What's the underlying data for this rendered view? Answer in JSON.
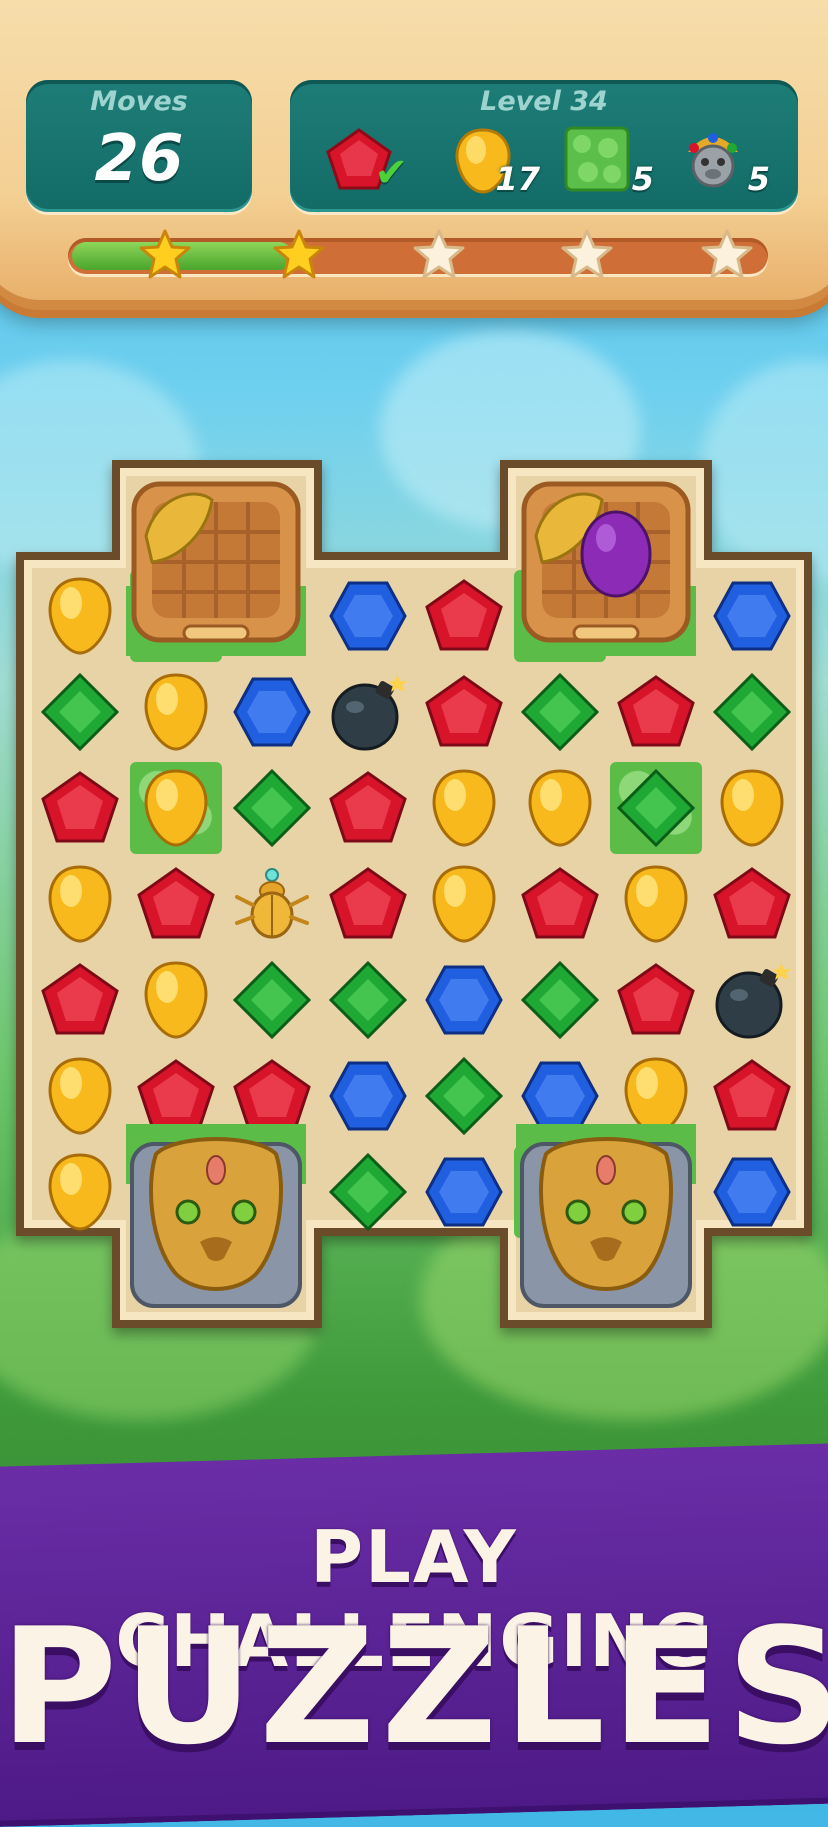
{
  "hud": {
    "moves_label": "Moves",
    "moves_value": "26",
    "level_label": "Level 34",
    "goals": [
      {
        "icon": "red-gem-icon",
        "count": "",
        "done": true
      },
      {
        "icon": "yellow-drop-gem-icon",
        "count": "17",
        "done": false
      },
      {
        "icon": "grass-tile-icon",
        "count": "5",
        "done": false
      },
      {
        "icon": "monkey-idol-icon",
        "count": "5",
        "done": false
      }
    ],
    "progress_fraction": 0.32,
    "stars_total": 5,
    "stars_earned": 2
  },
  "board": {
    "cols": 8,
    "rows": 7,
    "grid": [
      [
        "Y",
        "X",
        "X",
        "B",
        "R",
        "X",
        "X",
        "B"
      ],
      [
        "G",
        "Y",
        "B",
        "M",
        "R",
        "G",
        "R",
        "G"
      ],
      [
        "R",
        "Y",
        "G",
        "R",
        "Y",
        "Y",
        "G",
        "Y"
      ],
      [
        "Y",
        "R",
        "S",
        "R",
        "Y",
        "R",
        "Y",
        "R"
      ],
      [
        "R",
        "Y",
        "G",
        "G",
        "B",
        "G",
        "R",
        "M"
      ],
      [
        "Y",
        "R",
        "R",
        "B",
        "G",
        "B",
        "Y",
        "R"
      ],
      [
        "Y",
        "X",
        "X",
        "G",
        "B",
        "X",
        "X",
        "B"
      ]
    ],
    "grass_cells": [
      [
        2,
        1
      ],
      [
        2,
        6
      ],
      [
        0,
        1
      ],
      [
        0,
        5
      ],
      [
        6,
        1
      ],
      [
        6,
        5
      ]
    ],
    "special_objects": [
      {
        "type": "basket",
        "contents": "leaf",
        "icon": "basket-icon"
      },
      {
        "type": "basket",
        "contents": "leaf-and-purple-egg",
        "icon": "basket-icon"
      },
      {
        "type": "lion-statue",
        "icon": "lion-statue-icon"
      },
      {
        "type": "lion-statue",
        "icon": "lion-statue-icon"
      }
    ],
    "legend": {
      "R": "red-pentagon-gem",
      "Y": "yellow-drop-gem",
      "B": "blue-hexagon-gem",
      "G": "green-diamond-gem",
      "M": "bomb",
      "S": "golden-scarab"
    }
  },
  "banner": {
    "line1": "PLAY CHALLENGING",
    "line2": "PUZZLES",
    "color": "#5a2298"
  },
  "colors": {
    "red": "#d8142a",
    "yellow": "#f7b91c",
    "blue": "#1f5fe0",
    "green": "#1fa834",
    "panel": "#156e69",
    "board": "#e8d3a6"
  }
}
